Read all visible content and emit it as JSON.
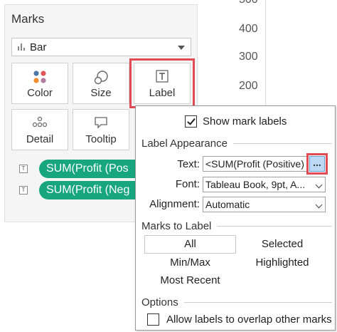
{
  "axis": {
    "ticks": [
      "500",
      "400",
      "300",
      "200"
    ]
  },
  "marks": {
    "title": "Marks",
    "mark_type": "Bar",
    "buttons": [
      {
        "id": "color",
        "label": "Color"
      },
      {
        "id": "size",
        "label": "Size"
      },
      {
        "id": "label",
        "label": "Label"
      },
      {
        "id": "detail",
        "label": "Detail"
      },
      {
        "id": "tooltip",
        "label": "Tooltip"
      }
    ],
    "pills": [
      {
        "text": "SUM(Profit (Pos"
      },
      {
        "text": "SUM(Profit (Neg"
      }
    ],
    "pill_color": "#17a67e"
  },
  "label_popup": {
    "show_mark_labels": "Show mark labels",
    "show_checked": true,
    "appearance_header": "Label Appearance",
    "text_label": "Text:",
    "text_value": "<SUM(Profit (Positive)",
    "ellipsis": "...",
    "font_label": "Font:",
    "font_value": "Tableau Book, 9pt, A...",
    "alignment_label": "Alignment:",
    "alignment_value": "Automatic",
    "marks_to_label_header": "Marks to Label",
    "options_left": [
      "All",
      "Min/Max",
      "Most Recent"
    ],
    "options_right": [
      "Selected",
      "Highlighted"
    ],
    "selected_option": "All",
    "options_header": "Options",
    "overlap_label": "Allow labels to overlap other marks",
    "overlap_checked": false
  },
  "highlight_color": "#e04b54"
}
